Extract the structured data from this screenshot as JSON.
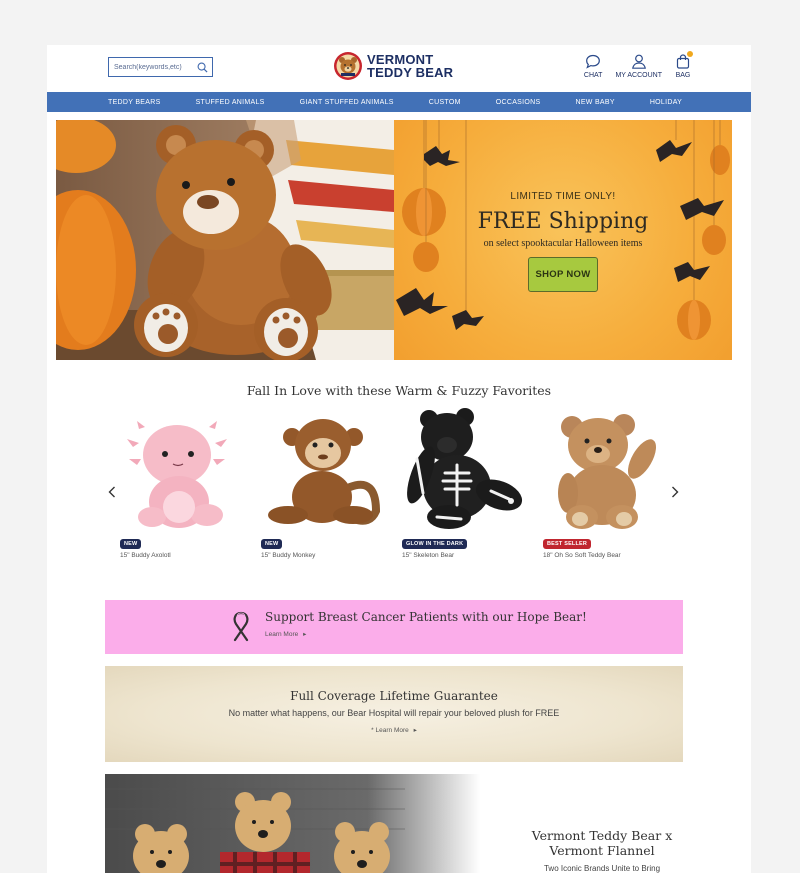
{
  "header": {
    "search_placeholder": "Search(keywords,etc)",
    "logo_line1": "VERMONT",
    "logo_line2": "TEDDY BEAR",
    "chat_label": "CHAT",
    "account_label": "MY ACCOUNT",
    "bag_label": "BAG",
    "bag_count": "0"
  },
  "nav": {
    "items": [
      "TEDDY BEARS",
      "STUFFED ANIMALS",
      "GIANT STUFFED ANIMALS",
      "CUSTOM",
      "OCCASIONS",
      "NEW BABY",
      "HOLIDAY"
    ]
  },
  "hero": {
    "limited": "LIMITED TIME ONLY!",
    "headline": "FREE Shipping",
    "sub": "on select spooktacular Halloween items",
    "cta": "SHOP NOW"
  },
  "favorites": {
    "title": "Fall In Love with these Warm & Fuzzy Favorites",
    "products": [
      {
        "badge": "NEW",
        "name": "15\" Buddy Axolotl"
      },
      {
        "badge": "NEW",
        "name": "15\" Buddy Monkey"
      },
      {
        "badge": "GLOW IN THE DARK",
        "name": "15\" Skeleton Bear"
      },
      {
        "badge": "BEST SELLER",
        "name": "18\" Oh So Soft Teddy Bear"
      }
    ]
  },
  "hope": {
    "title": "Support Breast Cancer Patients with our Hope Bear!",
    "link": "Learn More"
  },
  "guarantee": {
    "title": "Full Coverage Lifetime Guarantee",
    "text": "No matter what happens, our Bear Hospital will repair your beloved plush for FREE",
    "link": "* Learn More"
  },
  "flannel": {
    "title_line1": "Vermont Teddy Bear x",
    "title_line2": "Vermont Flannel",
    "sub": "Two Iconic Brands Unite to Bring"
  },
  "colors": {
    "nav_blue": "#4271b7",
    "navy": "#1d2f63",
    "badge_navy": "#1f2a55",
    "badge_red": "#c0262f",
    "promo_orange": "#f6ad3c",
    "cta_green": "#a7c93f",
    "hope_pink": "#fbadea"
  }
}
